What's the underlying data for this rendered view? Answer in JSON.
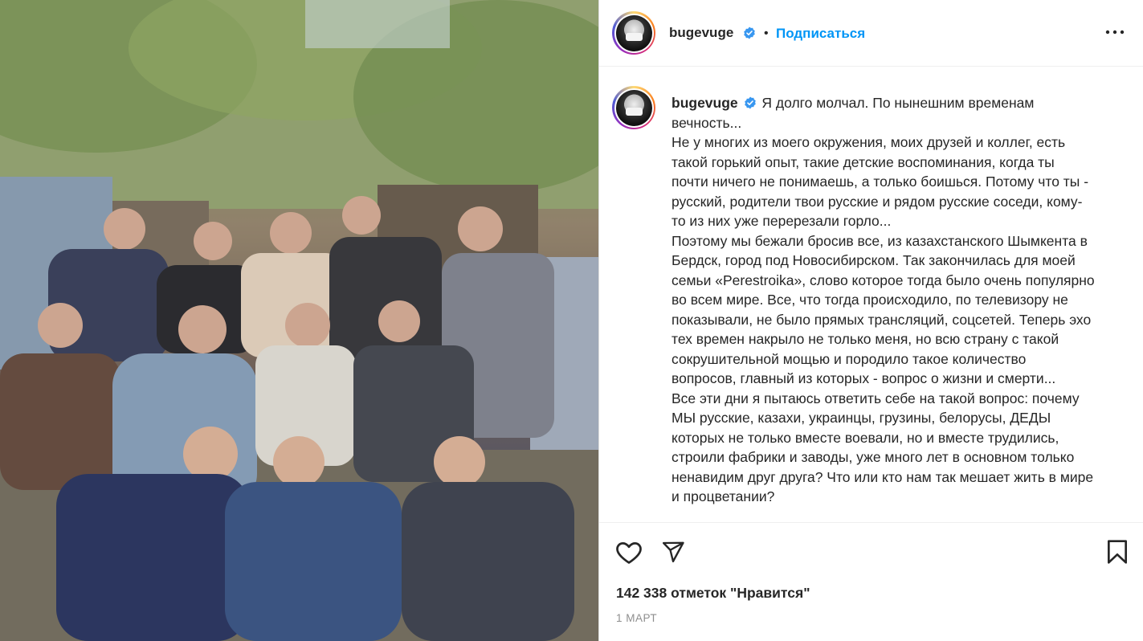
{
  "post": {
    "username": "bugevuge",
    "verified": true,
    "follow_label": "Подписаться",
    "separator": "•",
    "more_icon": "more-horizontal-icon",
    "accent_color": "#0095f6",
    "verified_color": "#3897f0"
  },
  "caption": {
    "username": "bugevuge",
    "lines": [
      "Я долго молчал. По нынешним временам",
      "вечность...",
      "Не у многих из моего окружения, моих друзей и коллег, есть",
      "такой горький опыт, такие детские воспоминания, когда ты",
      "почти ничего не понимаешь, а только боишься. Потому что ты -",
      "русский, родители твои русские и рядом русские соседи, кому-",
      "то из них уже перерезали горло...",
      "Поэтому мы бежали бросив все, из казахстанского Шымкента в",
      "Бердск, город под Новосибирском. Так закончилась для моей",
      "семьи «Perestroika», слово которое тогда было очень популярно",
      "во всем мире. Все, что тогда происходило, по телевизору не",
      "показывали, не было прямых трансляций, соцсетей. Теперь эхо",
      "тех времен накрыло не только меня, но всю страну с такой",
      "сокрушительной мощью и породило такое количество",
      "вопросов, главный из которых - вопрос о жизни и смерти...",
      "Все эти дни я пытаюсь ответить себе на такой вопрос: почему",
      "МЫ русские, казахи, украинцы, грузины, белорусы, ДЕДЫ",
      "которых не только вместе воевали, но и вместе трудились,",
      "строили фабрики и заводы, уже много лет в основном только",
      "ненавидим друг друга? Что или кто нам так мешает жить в мире",
      "и процветании?"
    ]
  },
  "actions": {
    "like_icon": "heart-icon",
    "share_icon": "send-icon",
    "save_icon": "bookmark-icon"
  },
  "likes_text": "142 338 отметок \"Нравится\"",
  "date_text": "1 МАРТ",
  "media": {
    "description_icon": "photo",
    "alt": ""
  }
}
